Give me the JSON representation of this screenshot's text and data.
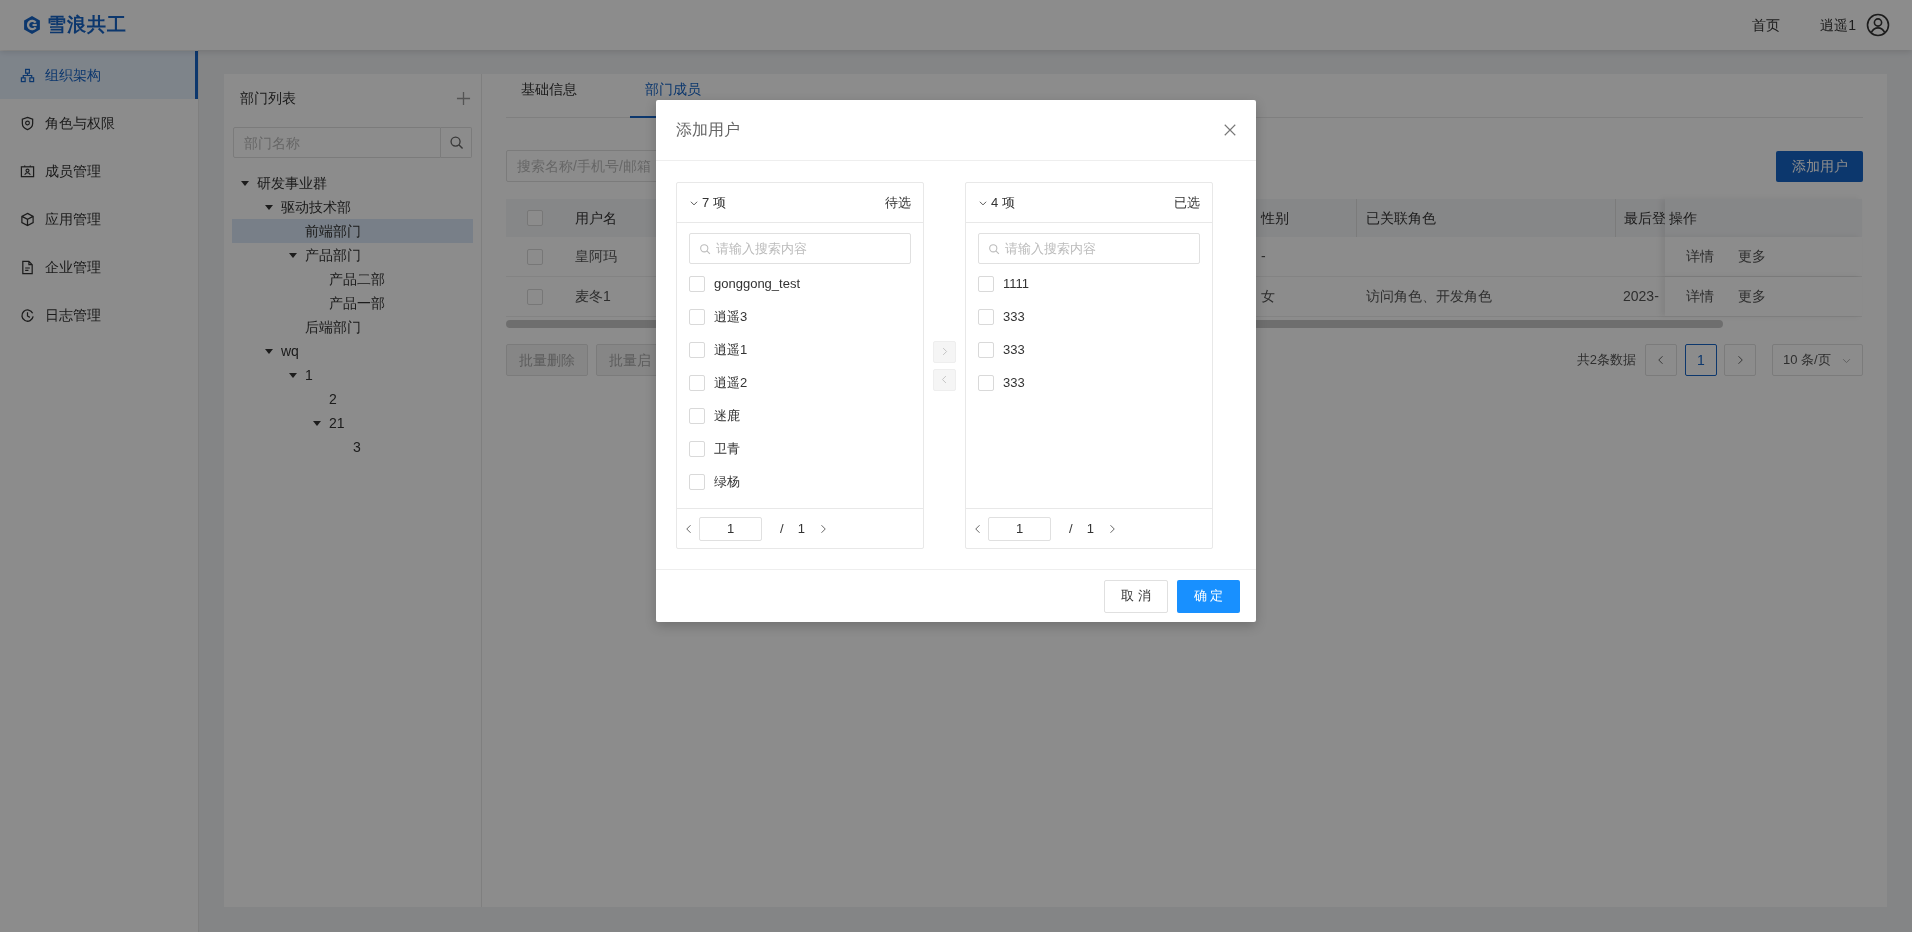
{
  "app": {
    "logo_text": "雪浪共工"
  },
  "header": {
    "nav_links": [
      {
        "label": "首页"
      }
    ],
    "user_name": "逍遥1"
  },
  "sidebar": {
    "items": [
      {
        "label": "组织架构",
        "selected": true
      },
      {
        "label": "角色与权限",
        "selected": false
      },
      {
        "label": "成员管理",
        "selected": false
      },
      {
        "label": "应用管理",
        "selected": false
      },
      {
        "label": "企业管理",
        "selected": false
      },
      {
        "label": "日志管理",
        "selected": false
      }
    ]
  },
  "department_panel": {
    "title": "部门列表",
    "search": {
      "placeholder": "部门名称"
    },
    "tree": [
      {
        "label": "研发事业群",
        "selected": false,
        "expanded": true,
        "children": [
          {
            "label": "驱动技术部",
            "selected": false,
            "expanded": true,
            "children": [
              {
                "label": "前端部门",
                "selected": true
              },
              {
                "label": "产品部门",
                "selected": false,
                "expanded": true,
                "children": [
                  {
                    "label": "产品二部",
                    "selected": false
                  },
                  {
                    "label": "产品一部",
                    "selected": false
                  }
                ]
              },
              {
                "label": "后端部门",
                "selected": false
              }
            ]
          },
          {
            "label": "wq",
            "selected": false,
            "expanded": true,
            "children": [
              {
                "label": "1",
                "selected": false,
                "expanded": true,
                "children": [
                  {
                    "label": "2",
                    "selected": false
                  },
                  {
                    "label": "21",
                    "selected": false,
                    "expanded": true,
                    "children": [
                      {
                        "label": "3",
                        "selected": false
                      }
                    ]
                  }
                ]
              }
            ]
          }
        ]
      }
    ]
  },
  "tabs": [
    {
      "label": "基础信息",
      "selected": false
    },
    {
      "label": "部门成员",
      "selected": true
    }
  ],
  "member_search": {
    "placeholder": "搜索名称/手机号/邮箱"
  },
  "add_user_button": "添加用户",
  "table": {
    "all_checked": false,
    "columns": [
      "用户名",
      "性别",
      "已关联角色",
      "最后登",
      "操作"
    ],
    "rows": [
      {
        "checked": false,
        "username": "皇阿玛",
        "gender": "-",
        "actions": [
          "详情",
          "更多"
        ]
      },
      {
        "checked": false,
        "username": "麦冬1",
        "gender": "女",
        "roles": "访问角色、开发角色",
        "last_login": "2023-",
        "actions": [
          "详情",
          "更多"
        ]
      }
    ]
  },
  "batch_buttons": [
    {
      "label": "批量删除",
      "disabled": true
    },
    {
      "label": "批量启",
      "disabled": true
    }
  ],
  "pagination": {
    "total": "共2条数据",
    "pages": [
      {
        "label": "1",
        "selected": true
      }
    ],
    "page_size": "10 条/页"
  },
  "dialog": {
    "title": "添加用户",
    "panels": [
      {
        "count": "7 项",
        "title": "待选",
        "search_placeholder": "请输入搜索内容",
        "items": [
          {
            "label": "gonggong_test",
            "checked": false
          },
          {
            "label": "逍遥3",
            "checked": false
          },
          {
            "label": "逍遥1",
            "checked": false
          },
          {
            "label": "逍遥2",
            "checked": false
          },
          {
            "label": "迷鹿",
            "checked": false
          },
          {
            "label": "卫青",
            "checked": false
          },
          {
            "label": "绿杨",
            "checked": false
          }
        ],
        "page": "1",
        "separator": "/",
        "total_pages": "1"
      },
      {
        "count": "4 项",
        "title": "已选",
        "search_placeholder": "请输入搜索内容",
        "items": [
          {
            "label": "1111",
            "checked": false
          },
          {
            "label": "333",
            "checked": false
          },
          {
            "label": "333",
            "checked": false
          },
          {
            "label": "333",
            "checked": false
          }
        ],
        "page": "1",
        "separator": "/",
        "total_pages": "1"
      }
    ],
    "move_buttons": [
      {
        "kind": "right",
        "disabled": true
      },
      {
        "kind": "left",
        "disabled": true
      }
    ],
    "cancel_button": "取 消",
    "ok_button": "确 定"
  }
}
